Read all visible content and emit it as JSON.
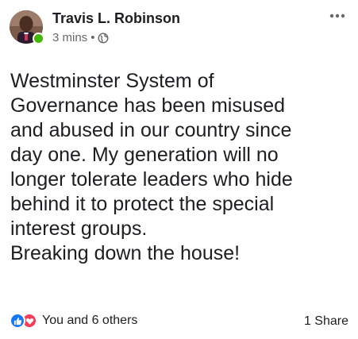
{
  "post": {
    "author": "Travis L. Robinson",
    "time": "3 mins",
    "separator": "•",
    "privacy_icon": "globe-icon",
    "more_icon": "more-options-icon",
    "lines": [
      "Westminster System of",
      "Governance has been misused",
      "and abused in our country since",
      "day one. My generation will no",
      "longer tolerate leaders who hide",
      "behind it to protect the special",
      "interest groups.",
      "Breaking down the house!"
    ]
  },
  "footer": {
    "reaction_icons": [
      "like-icon",
      "love-icon"
    ],
    "reactions_text": "You and 6 others",
    "shares_text": "1 Share"
  },
  "colors": {
    "text": "#1c1e21",
    "muted": "#65676b",
    "like_blue": "#1877f2",
    "love_red": "#f33e58",
    "online_green": "#44b700"
  }
}
